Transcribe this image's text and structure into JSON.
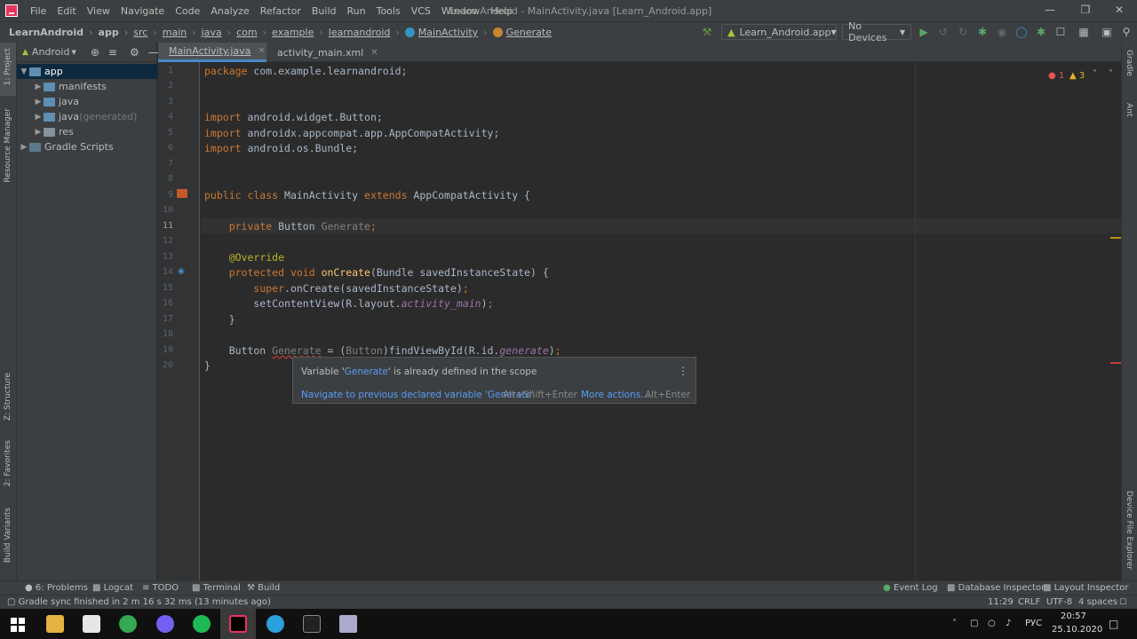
{
  "menubar": {
    "items": [
      "File",
      "Edit",
      "View",
      "Navigate",
      "Code",
      "Analyze",
      "Refactor",
      "Build",
      "Run",
      "Tools",
      "VCS",
      "Window",
      "Help"
    ],
    "window_title": "Learn Android - MainActivity.java [Learn_Android.app]"
  },
  "breadcrumbs": [
    "LearnAndroid",
    "app",
    "src",
    "main",
    "java",
    "com",
    "example",
    "learnandroid",
    "MainActivity",
    "Generate"
  ],
  "toolbar": {
    "run_config": "Learn_Android.app",
    "device": "No Devices"
  },
  "left_strip": {
    "project": "1: Project",
    "resource_manager": "Resource Manager",
    "structure": "Z: Structure",
    "favorites": "2: Favorites",
    "build_variants": "Build Variants"
  },
  "right_strip": {
    "gradle": "Gradle",
    "ant": "Ant",
    "device_file_explorer": "Device File Explorer"
  },
  "project": {
    "view_mode": "Android",
    "tree": [
      {
        "label": "app",
        "suffix": ""
      },
      {
        "label": "manifests",
        "suffix": ""
      },
      {
        "label": "java",
        "suffix": ""
      },
      {
        "label": "java",
        "suffix": " (generated)"
      },
      {
        "label": "res",
        "suffix": ""
      },
      {
        "label": "Gradle Scripts",
        "suffix": ""
      }
    ]
  },
  "tabs": [
    "MainActivity.java",
    "activity_main.xml"
  ],
  "inspection": {
    "errors": "1",
    "warnings": "3"
  },
  "code": {
    "lines": [
      "1",
      "2",
      "3",
      "4",
      "5",
      "6",
      "7",
      "8",
      "9",
      "10",
      "11",
      "12",
      "13",
      "14",
      "15",
      "16",
      "17",
      "18",
      "19",
      "20"
    ]
  },
  "popup": {
    "msg_before": "Variable '",
    "var_name": "Generate",
    "msg_after": "' is already defined in the scope",
    "action1": "Navigate to previous declared variable 'Generate'",
    "action1_shortcut": "Alt+Shift+Enter",
    "action2": "More actions...",
    "action2_shortcut": "Alt+Enter"
  },
  "bottom_tools": {
    "problems": "6: Problems",
    "logcat": "Logcat",
    "todo": "TODO",
    "terminal": "Terminal",
    "build": "Build",
    "event_log": "Event Log",
    "db_inspector": "Database Inspector",
    "layout_inspector": "Layout Inspector"
  },
  "status": {
    "message": "Gradle sync finished in 2 m 16 s 32 ms (13 minutes ago)",
    "position": "11:29",
    "line_sep": "CRLF",
    "encoding": "UTF-8",
    "indent": "4 spaces"
  },
  "taskbar": {
    "lang": "РУС",
    "time": "20:57",
    "date": "25.10.2020"
  },
  "colors": {
    "accent": "#4a88c7",
    "error": "#e05555",
    "warning": "#e6b422"
  }
}
